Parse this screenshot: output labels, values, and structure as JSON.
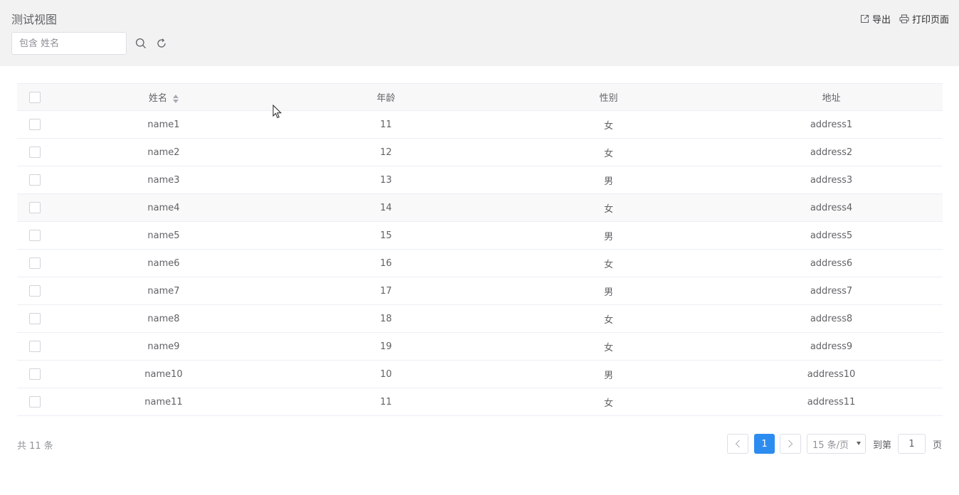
{
  "header": {
    "title": "测试视图",
    "search_placeholder": "包含 姓名",
    "export_label": "导出",
    "print_label": "打印页面"
  },
  "table": {
    "columns": [
      "姓名",
      "年龄",
      "性别",
      "地址"
    ],
    "rows": [
      [
        "name1",
        "11",
        "女",
        "address1"
      ],
      [
        "name2",
        "12",
        "女",
        "address2"
      ],
      [
        "name3",
        "13",
        "男",
        "address3"
      ],
      [
        "name4",
        "14",
        "女",
        "address4"
      ],
      [
        "name5",
        "15",
        "男",
        "address5"
      ],
      [
        "name6",
        "16",
        "女",
        "address6"
      ],
      [
        "name7",
        "17",
        "男",
        "address7"
      ],
      [
        "name8",
        "18",
        "女",
        "address8"
      ],
      [
        "name9",
        "19",
        "女",
        "address9"
      ],
      [
        "name10",
        "10",
        "男",
        "address10"
      ],
      [
        "name11",
        "11",
        "女",
        "address11"
      ]
    ]
  },
  "pagination": {
    "total_text": "共 11 条",
    "current_page": "1",
    "page_size": "15 条/页",
    "goto_label": "到第",
    "goto_value": "1",
    "page_suffix": "页"
  },
  "colors": {
    "accent": "#2d8cf0",
    "header_bg": "#f2f2f2"
  }
}
